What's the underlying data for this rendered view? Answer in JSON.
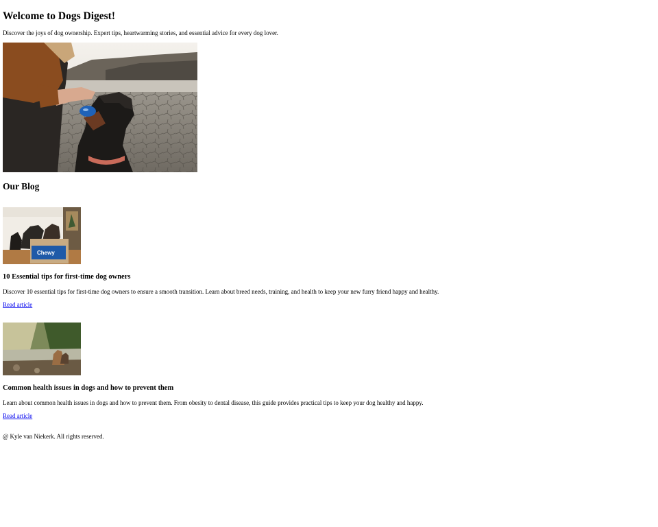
{
  "hero": {
    "title": "Welcome to Dogs Digest!",
    "text": "Discover the joys of dog ownership. Expert tips, heartwarming stories, and essential advice for every dog lover."
  },
  "blog": {
    "title": "Our Blog",
    "posts": [
      {
        "title": "10 Essential tips for first-time dog owners",
        "text": "Discover 10 essential tips for first-time dog owners to ensure a smooth transition. Learn about breed needs, training, and health to keep your new furry friend happy and healthy.",
        "link": "Read article",
        "image_logo": "Chewy"
      },
      {
        "title": "Common health issues in dogs and how to prevent them",
        "text": "Learn about common health issues in dogs and how to prevent them. From obesity to dental disease, this guide provides practical tips to keep your dog healthy and happy.",
        "link": "Read article"
      }
    ]
  },
  "footer": {
    "text": "@ Kyle van Niekerk. All rights reserved."
  },
  "colors": {
    "link": "#0000ee",
    "text": "#000000",
    "background": "#ffffff"
  }
}
